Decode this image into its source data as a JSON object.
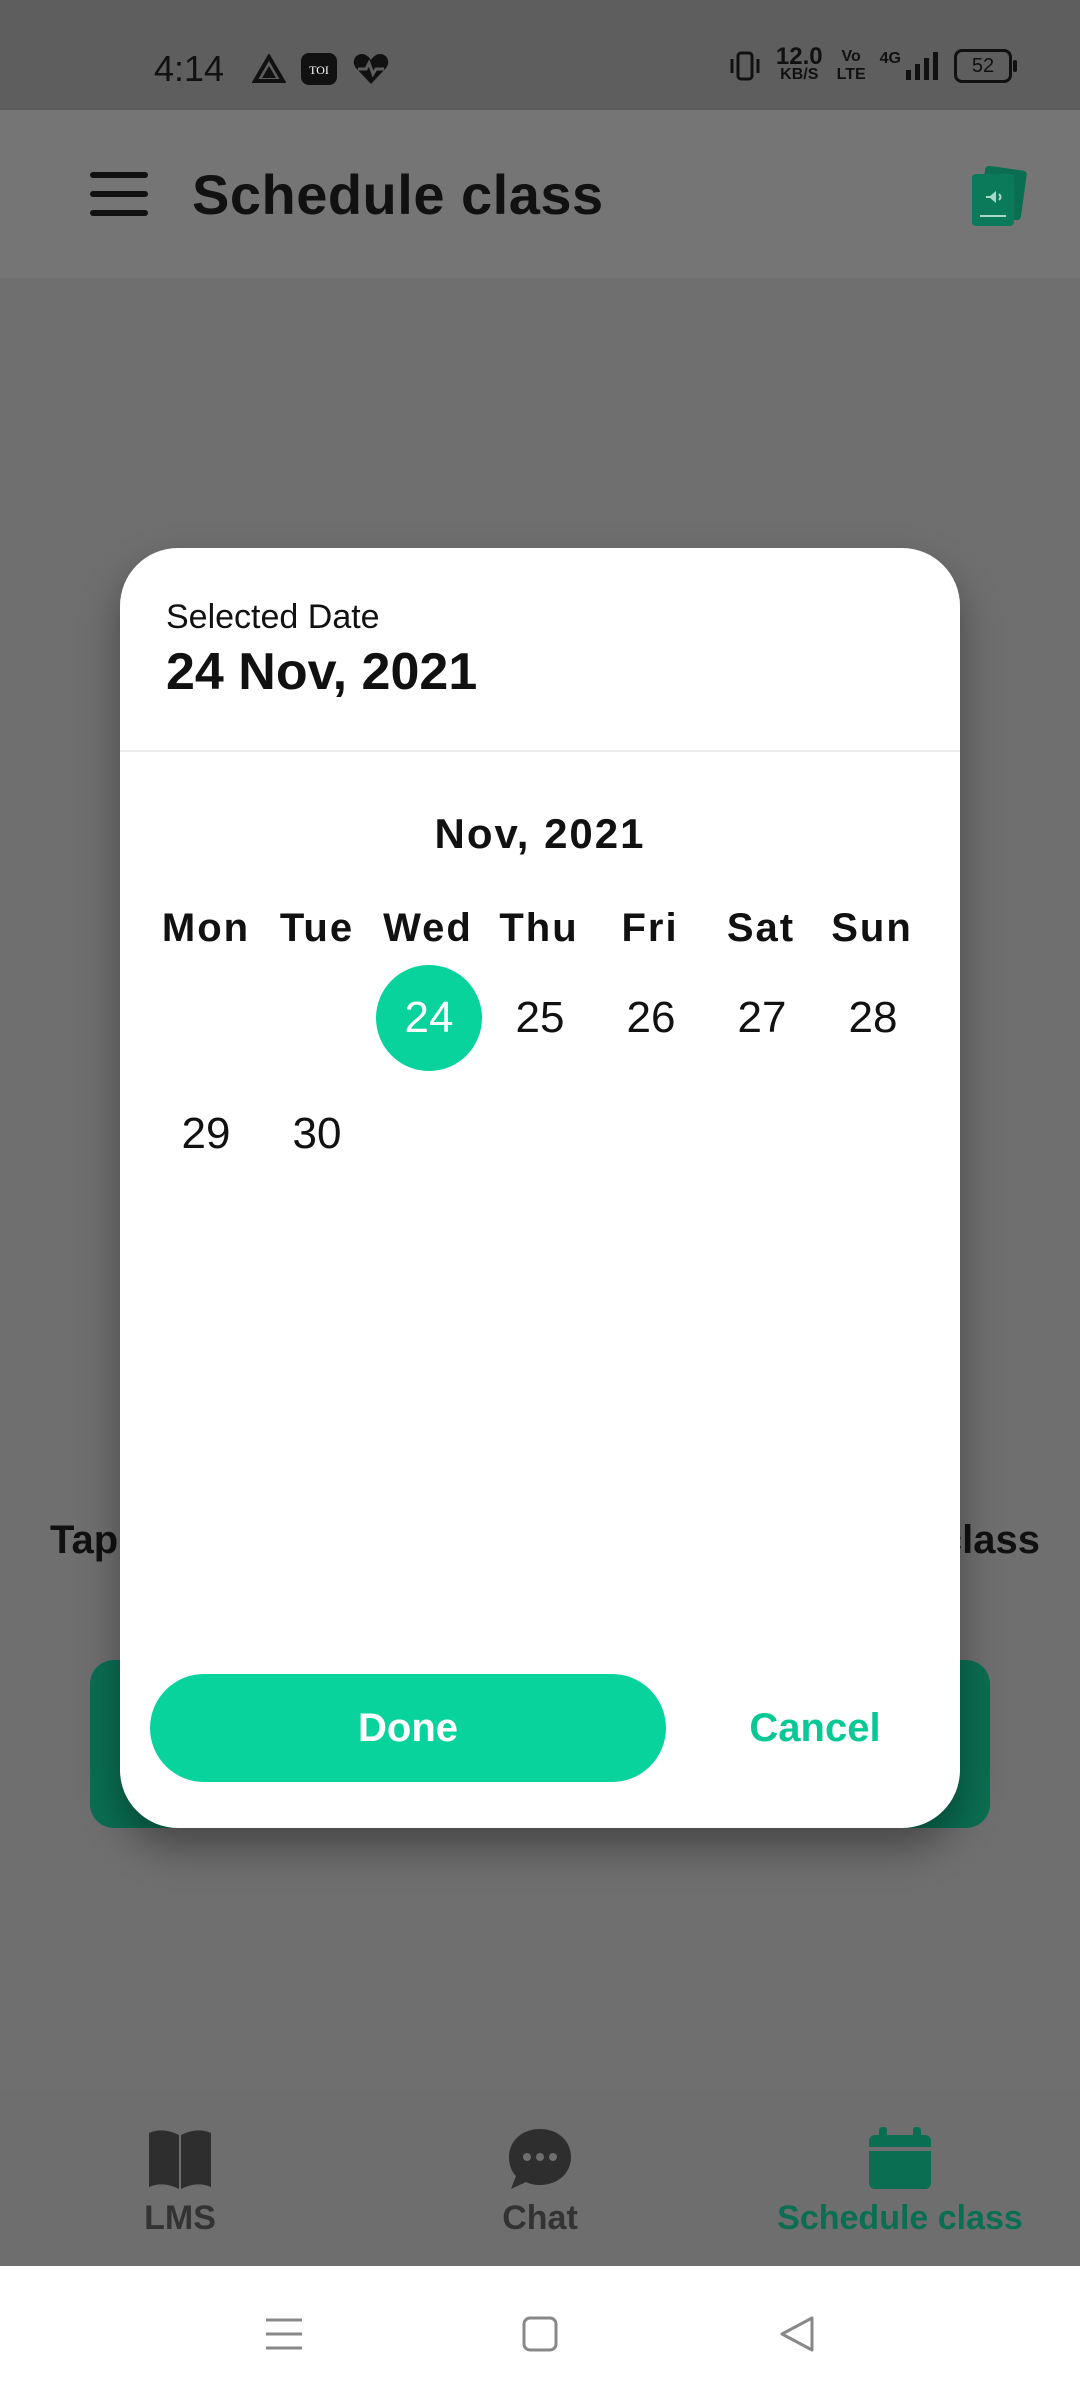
{
  "status_bar": {
    "time": "4:14",
    "left_icons": [
      "drive-icon",
      "toi-icon",
      "health-heart-icon"
    ],
    "network_speed": "12.0",
    "network_speed_unit": "KB/S",
    "volte_label": "Vo",
    "lte_label": "LTE",
    "network_type": "4G",
    "battery": "52"
  },
  "app_bar": {
    "title": "Schedule class"
  },
  "background": {
    "left_text": "Tap",
    "right_text": "class"
  },
  "dialog": {
    "selected_label": "Selected Date",
    "selected_date": "24 Nov, 2021",
    "month_title": "Nov, 2021",
    "weekdays": [
      "Mon",
      "Tue",
      "Wed",
      "Thu",
      "Fri",
      "Sat",
      "Sun"
    ],
    "week1": [
      "24",
      "25",
      "26",
      "27",
      "28"
    ],
    "week2": [
      "29",
      "30"
    ],
    "selected_day": "24",
    "done_label": "Done",
    "cancel_label": "Cancel"
  },
  "bottom_nav": {
    "items": [
      {
        "label": "LMS",
        "icon": "book-icon"
      },
      {
        "label": "Chat",
        "icon": "chat-bubble-icon"
      },
      {
        "label": "Schedule class",
        "icon": "calendar-icon",
        "active": true
      }
    ]
  },
  "colors": {
    "accent": "#08d39d",
    "active_nav": "#0a6e52"
  }
}
